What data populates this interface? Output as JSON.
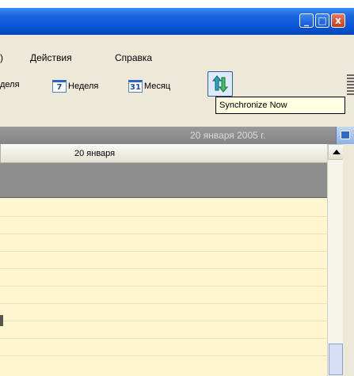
{
  "title_bar": {
    "minimize_label": "_",
    "maximize_label": "□",
    "close_label": "x"
  },
  "menu": {
    "partial_item": ")",
    "actions": "Действия",
    "help": "Справка"
  },
  "toolbar": {
    "day_label": "деля",
    "week_icon": "7",
    "week_label": "Неделя",
    "month_icon": "31",
    "month_label": "Месяц",
    "sync_icon": "sync-icon"
  },
  "tooltip": {
    "text": "Synchronize Now"
  },
  "date_band": {
    "text": "20 января 2005 г."
  },
  "day_view": {
    "column_header": "20 января"
  },
  "colors": {
    "title_bar": "#0a55d8",
    "grid_background": "#fff5d0",
    "selection_band": "#8e8e8e",
    "tooltip_background": "#ffffe1"
  }
}
